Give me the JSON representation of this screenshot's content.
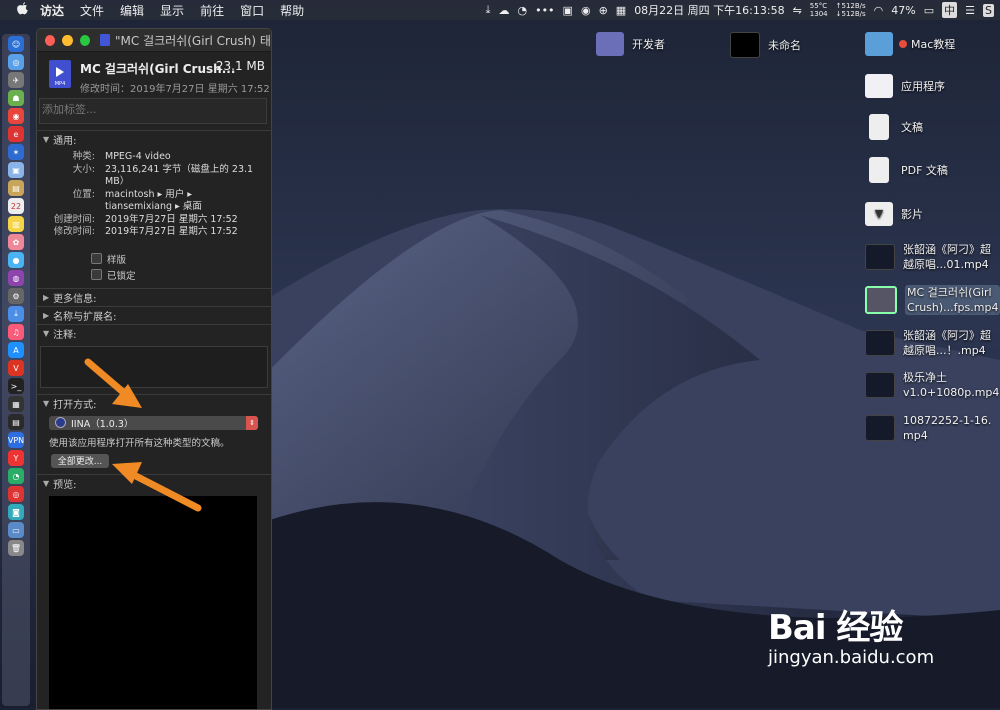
{
  "menubar": {
    "apple": "",
    "menus": [
      "访达",
      "文件",
      "编辑",
      "显示",
      "前往",
      "窗口",
      "帮助"
    ],
    "temp": "55°C",
    "rpm": "1304",
    "net_up": "↑512B/s",
    "net_down": "↓512B/s",
    "date": "08月22日 周四 下午16:13:58",
    "battery": "47%",
    "ime": "中"
  },
  "window": {
    "title": "\"MC 걸크러쉬(Girl Crush) 태...",
    "file_name": "MC 걸크러쉬(Girl Crush...",
    "file_size": "23.1 MB",
    "modified_header": "修改时间：2019年7月27日 星期六 17:52",
    "tags_placeholder": "添加标签...",
    "general": {
      "title": "通用:",
      "rows": [
        {
          "k": "种类:",
          "v": "MPEG-4 video"
        },
        {
          "k": "大小:",
          "v": "23,116,241 字节（磁盘上的 23.1 MB）"
        },
        {
          "k": "位置:",
          "v": "macintosh ▸ 用户 ▸ tiansemixiang ▸ 桌面"
        },
        {
          "k": "创建时间:",
          "v": "2019年7月27日 星期六 17:52"
        },
        {
          "k": "修改时间:",
          "v": "2019年7月27日 星期六 17:52"
        }
      ],
      "stationery": "样版",
      "locked": "已锁定"
    },
    "more_info": "更多信息:",
    "name_ext": "名称与扩展名:",
    "comments": "注释:",
    "open_with": {
      "title": "打开方式:",
      "app": "IINA（1.0.3）",
      "hint": "使用该应用程序打开所有这种类型的文稿。",
      "change_all": "全部更改..."
    },
    "preview": "预览:"
  },
  "desktop": {
    "items": [
      {
        "label": "开发者"
      },
      {
        "label": "未命名"
      },
      {
        "label": "Mac教程"
      },
      {
        "label": "应用程序"
      },
      {
        "label": "文稿"
      },
      {
        "label": "PDF 文稿"
      },
      {
        "label": "影片"
      },
      {
        "label1": "张韶涵《阿刁》超",
        "label2": "越原唱...01.mp4"
      },
      {
        "label1": "MC 걸크러쉬(Girl",
        "label2": "Crush)...fps.mp4"
      },
      {
        "label1": "张韶涵《阿刁》超",
        "label2": "越原唱...！.mp4"
      },
      {
        "label1": "极乐净土",
        "label2": "v1.0+1080p.mp4"
      },
      {
        "label1": "10872252-1-16.",
        "label2": "mp4"
      }
    ]
  },
  "watermark": {
    "brand": "Bai 经验",
    "url": "jingyan.baidu.com"
  }
}
